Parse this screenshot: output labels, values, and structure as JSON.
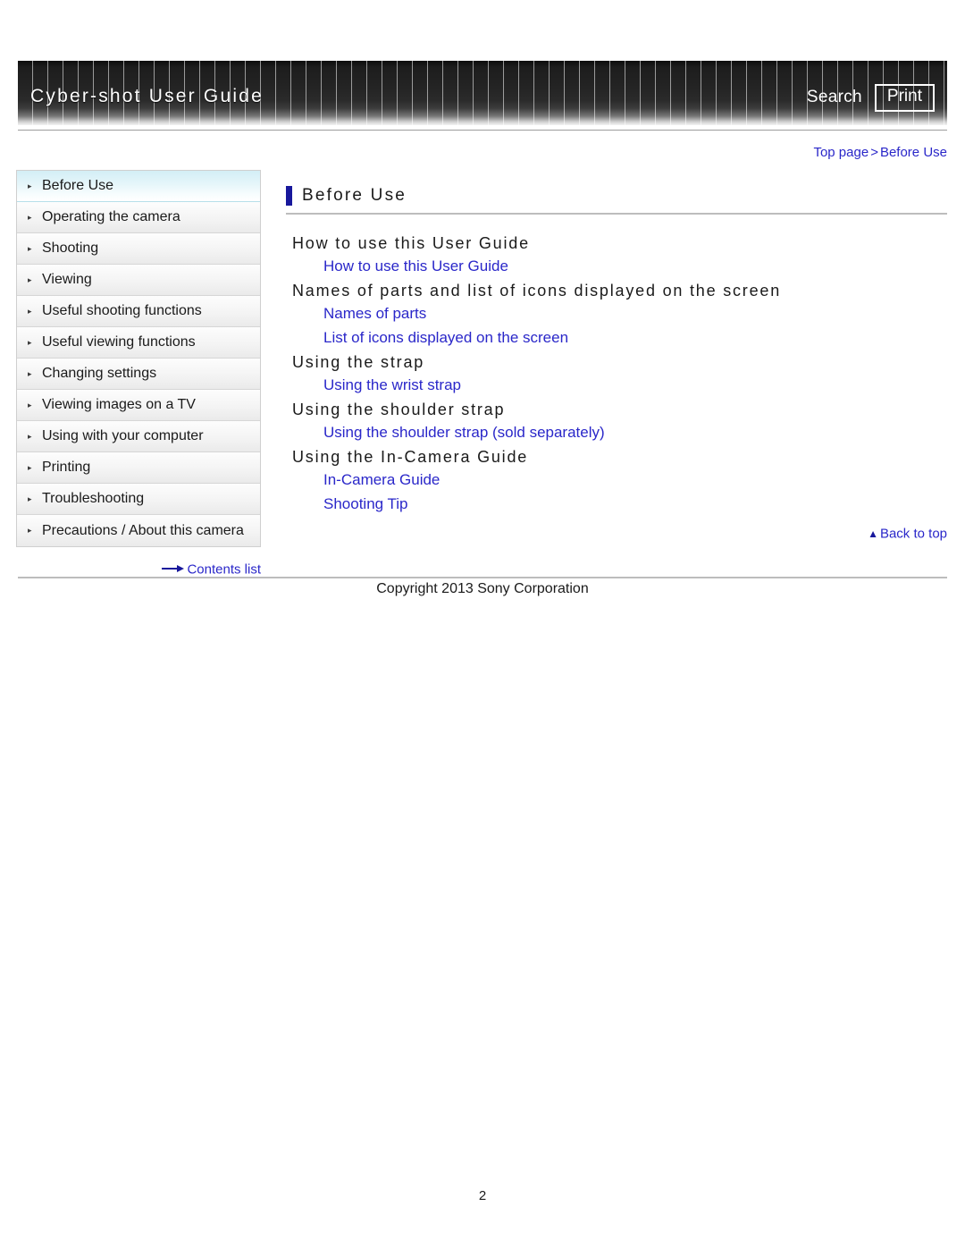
{
  "header": {
    "title": "Cyber-shot User Guide",
    "search_label": "Search",
    "print_label": "Print"
  },
  "breadcrumb": {
    "top_page": "Top page",
    "separator": ">",
    "current": "Before Use"
  },
  "sidebar": {
    "items": [
      {
        "label": "Before Use",
        "active": true
      },
      {
        "label": "Operating the camera",
        "active": false
      },
      {
        "label": "Shooting",
        "active": false
      },
      {
        "label": "Viewing",
        "active": false
      },
      {
        "label": "Useful shooting functions",
        "active": false
      },
      {
        "label": "Useful viewing functions",
        "active": false
      },
      {
        "label": "Changing settings",
        "active": false
      },
      {
        "label": "Viewing images on a TV",
        "active": false
      },
      {
        "label": "Using with your computer",
        "active": false
      },
      {
        "label": "Printing",
        "active": false
      },
      {
        "label": "Troubleshooting",
        "active": false
      },
      {
        "label": "Precautions / About this camera",
        "active": false
      }
    ],
    "contents_list_label": "Contents list"
  },
  "main": {
    "page_title": "Before Use",
    "sections": [
      {
        "heading": "How to use this User Guide",
        "links": [
          "How to use this User Guide"
        ]
      },
      {
        "heading": "Names of parts and list of icons displayed on the screen",
        "links": [
          "Names of parts",
          "List of icons displayed on the screen"
        ]
      },
      {
        "heading": "Using the strap",
        "links": [
          "Using the wrist strap"
        ]
      },
      {
        "heading": "Using the shoulder strap",
        "links": [
          "Using the shoulder strap (sold separately)"
        ]
      },
      {
        "heading": "Using the In-Camera Guide",
        "links": [
          "In-Camera Guide",
          "Shooting Tip"
        ]
      }
    ],
    "back_to_top_label": "Back to top"
  },
  "footer": {
    "copyright": "Copyright 2013 Sony Corporation",
    "page_number": "2"
  },
  "colors": {
    "link_blue": "#2a27c9",
    "marker_navy": "#18189c",
    "active_nav": "#d3eef6",
    "banner_dark": "#1d1d1d"
  }
}
